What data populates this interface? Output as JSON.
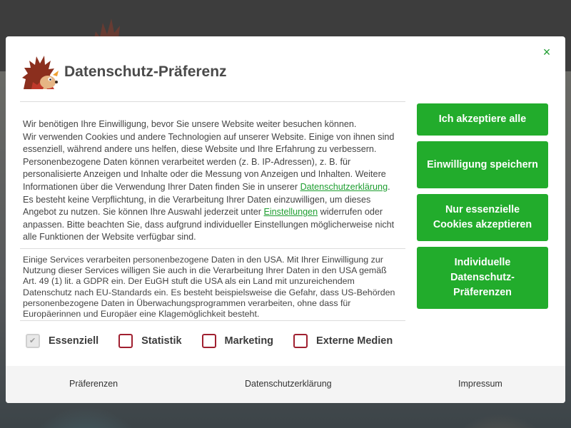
{
  "modal": {
    "title": "Datenschutz-Präferenz",
    "close_symbol": "×",
    "intro": {
      "line1": "Wir benötigen Ihre Einwilligung, bevor Sie unsere Website weiter besuchen können.",
      "part1": "Wir verwenden Cookies und andere Technologien auf unserer Website. Einige von ihnen sind essenziell, während andere uns helfen, diese Website und Ihre Erfahrung zu verbessern. Personenbezogene Daten können verarbeitet werden (z. B. IP-Adressen), z. B. für personalisierte Anzeigen und Inhalte oder die Messung von Anzeigen und Inhalten. Weitere Informationen über die Verwendung Ihrer Daten finden Sie in unserer ",
      "link1": "Datenschutzerklärung",
      "part2": ". Es besteht keine Verpflichtung, in die Verarbeitung Ihrer Daten einzuwilligen, um dieses Angebot zu nutzen. Sie können Ihre Auswahl jederzeit unter ",
      "link2": "Einstellungen",
      "part3": " widerrufen oder anpassen. Bitte beachten Sie, dass aufgrund individueller Einstellungen möglicherweise nicht alle Funktionen der Website verfügbar sind."
    },
    "usa_text": "Einige Services verarbeiten personenbezogene Daten in den USA. Mit Ihrer Einwilligung zur Nutzung dieser Services willigen Sie auch in die Verarbeitung Ihrer Daten in den USA gemäß Art. 49 (1) lit. a GDPR ein. Der EuGH stuft die USA als ein Land mit unzureichendem Datenschutz nach EU-Standards ein. Es besteht beispielsweise die Gefahr, dass US-Behörden personenbezogene Daten in Überwachungsprogrammen verarbeiten, ohne dass für Europäerinnen und Europäer eine Klagemöglichkeit besteht.",
    "checkboxes": [
      {
        "label": "Essenziell",
        "checked": true,
        "disabled": true
      },
      {
        "label": "Statistik",
        "checked": false
      },
      {
        "label": "Marketing",
        "checked": false
      },
      {
        "label": "Externe Medien",
        "checked": false
      }
    ],
    "buttons": {
      "accept_all": "Ich akzeptiere alle",
      "save": "Einwilligung speichern",
      "essential": "Nur essenzielle Cookies akzeptieren",
      "individual": "Individuelle Datenschutz-Präferenzen"
    },
    "footer": {
      "preferences": "Präferenzen",
      "privacy": "Datenschutzerklärung",
      "imprint": "Impressum"
    }
  },
  "colors": {
    "accent": "#22ac2c",
    "link": "#1e9e30",
    "checkbox_border": "#a02030"
  },
  "icons": {
    "logo": "hedgehog-logo-icon",
    "close": "close-icon",
    "check": "checkmark-icon"
  }
}
